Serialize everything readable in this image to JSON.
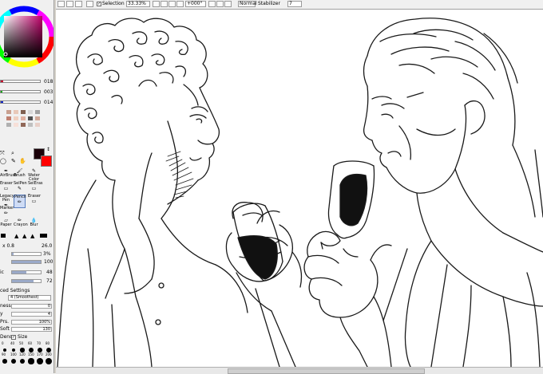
{
  "colors": {
    "primary": "#1a0008",
    "secondary": "#ff0000",
    "slider_r": "#c8002a",
    "slider_g": "#00a800",
    "slider_b": "#1428c8",
    "sketch": "#1a1a1a",
    "selected": "#5a7fc0"
  },
  "toolbar": {
    "selection_label": "Selection",
    "zoom_value": "33.33%",
    "rotation_value": "+000°",
    "blend_mode": "Normal",
    "stabilizer_label": "Stabilizer",
    "stabilizer_value": "7"
  },
  "color_panel": {
    "r": "018",
    "g": "003",
    "b": "014",
    "slider_r": 0.07,
    "slider_g": 0.01,
    "slider_b": 0.055
  },
  "swatches": [
    "#c8a090",
    "#e8c8b8",
    "#806050",
    "#d8d8d8",
    "#a0a0a0",
    "#c08070",
    "#f0d0c0",
    "#e0b0a0",
    "#505050",
    "#d0a898",
    "#b0b0b0",
    "#f8e0d8",
    "#906858",
    "#c0c0c0",
    "#e8d0c8"
  ],
  "tools": {
    "row1": [
      "AirBrush",
      "Brush",
      "Water Color"
    ],
    "row2": [
      "Eraser",
      "SelPen",
      "SelEras"
    ],
    "row3": [
      "Legacy Pen",
      "Pencil",
      "Eraser"
    ],
    "row4": [
      "Marker"
    ],
    "row5": [
      "Paper",
      "Crayon",
      "Blur"
    ]
  },
  "brush_settings": {
    "size_mult": "x 0.8",
    "size": "26.0",
    "min_size": "3%",
    "density": "100",
    "texture_label": "ic",
    "texture_value": "48",
    "texture_value2": "72",
    "advanced_label": "ced Settings",
    "quality": "4 (Smoothest)",
    "edge_label": "ness",
    "edge_value": "0",
    "y_label": "y",
    "y_value": "4",
    "prs_label": "Prs.",
    "prs_value": "100%",
    "soft_label": "Soft",
    "soft_value": "130",
    "dens_label": "Dens",
    "size_label": "Size",
    "brush_size_labels": [
      "0",
      "40",
      "50",
      "60",
      "70",
      "80",
      "90",
      "100",
      "120",
      "150",
      "170",
      "200"
    ]
  }
}
